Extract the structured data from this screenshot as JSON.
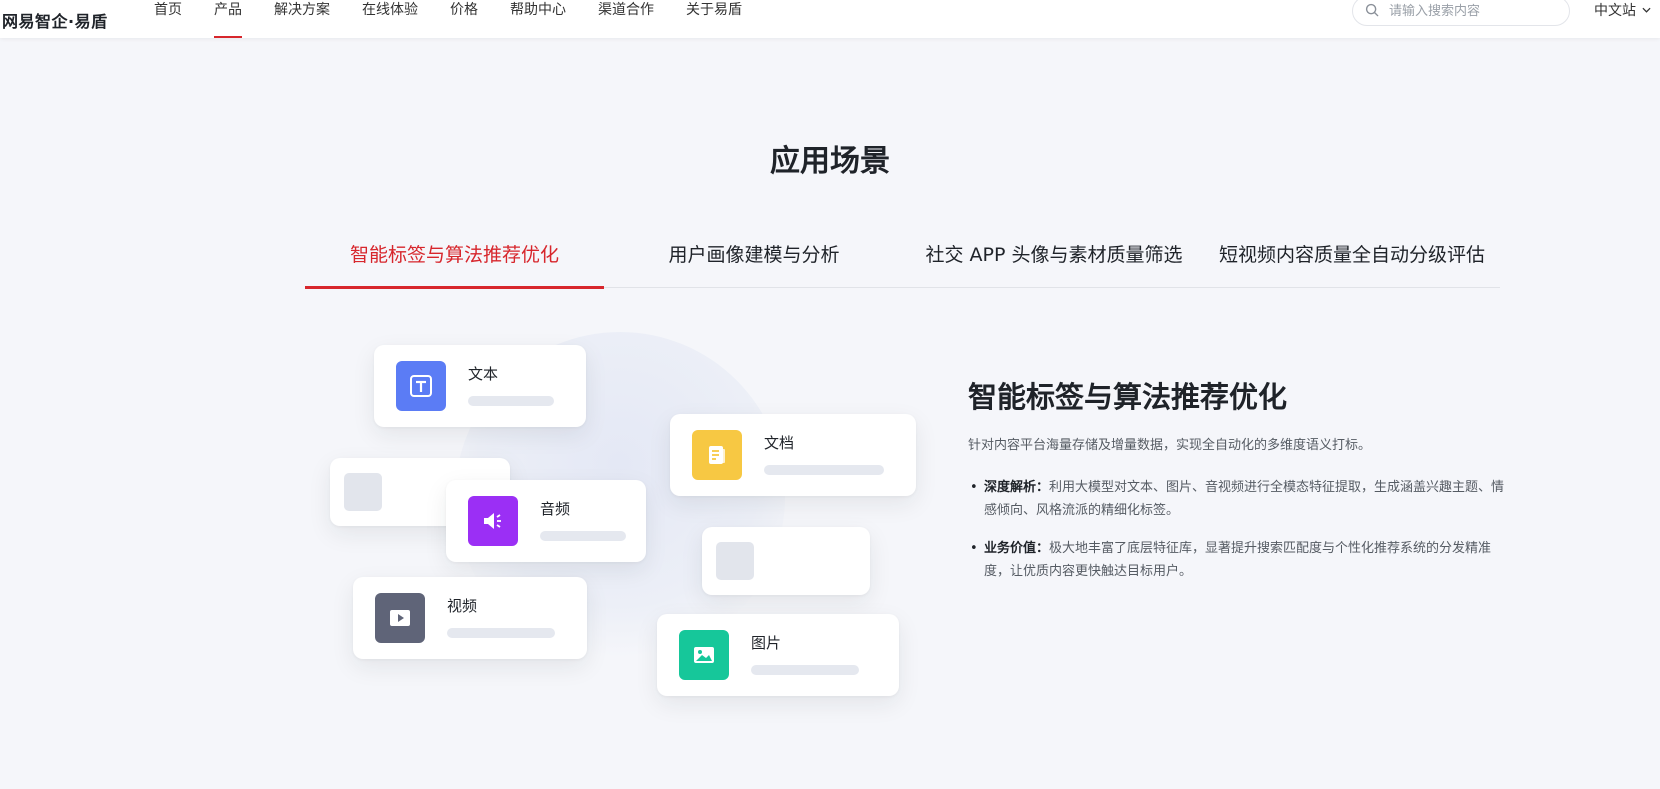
{
  "header": {
    "logo": "网易智企·易盾",
    "nav": [
      {
        "label": "首页"
      },
      {
        "label": "产品"
      },
      {
        "label": "解决方案"
      },
      {
        "label": "在线体验"
      },
      {
        "label": "价格"
      },
      {
        "label": "帮助中心"
      },
      {
        "label": "渠道合作"
      },
      {
        "label": "关于易盾"
      }
    ],
    "active_nav": "产品",
    "search_placeholder": "请输入搜索内容",
    "lang": "中文站"
  },
  "section": {
    "title": "应用场景",
    "tabs": [
      {
        "label": "智能标签与算法推荐优化"
      },
      {
        "label": "用户画像建模与分析"
      },
      {
        "label": "社交 APP 头像与素材质量筛选"
      },
      {
        "label": "短视频内容质量全自动分级评估"
      }
    ],
    "active_tab": "智能标签与算法推荐优化"
  },
  "illustration": {
    "cards": [
      {
        "label": "文本",
        "icon": "text-icon",
        "color": "#5b7cf5"
      },
      {
        "label": "文档",
        "icon": "document-icon",
        "color": "#f7c843"
      },
      {
        "label": "音频",
        "icon": "audio-icon",
        "color": "#9b2ff5"
      },
      {
        "label": "视频",
        "icon": "video-icon",
        "color": "#5f6478"
      },
      {
        "label": "图片",
        "icon": "image-icon",
        "color": "#16c79a"
      }
    ]
  },
  "detail": {
    "title": "智能标签与算法推荐优化",
    "description": "针对内容平台海量存储及增量数据，实现全自动化的多维度语义打标。",
    "bullets": [
      {
        "label": "深度解析：",
        "text": "利用大模型对文本、图片、音视频进行全模态特征提取，生成涵盖兴趣主题、情感倾向、风格流派的精细化标签。"
      },
      {
        "label": "业务价值：",
        "text": "极大地丰富了底层特征库，显著提升搜索匹配度与个性化推荐系统的分发精准度，让优质内容更快触达目标用户。"
      }
    ]
  },
  "colors": {
    "accent": "#d7262c",
    "text": "#1f2329",
    "muted": "#555b63",
    "background": "#f5f6fa"
  }
}
